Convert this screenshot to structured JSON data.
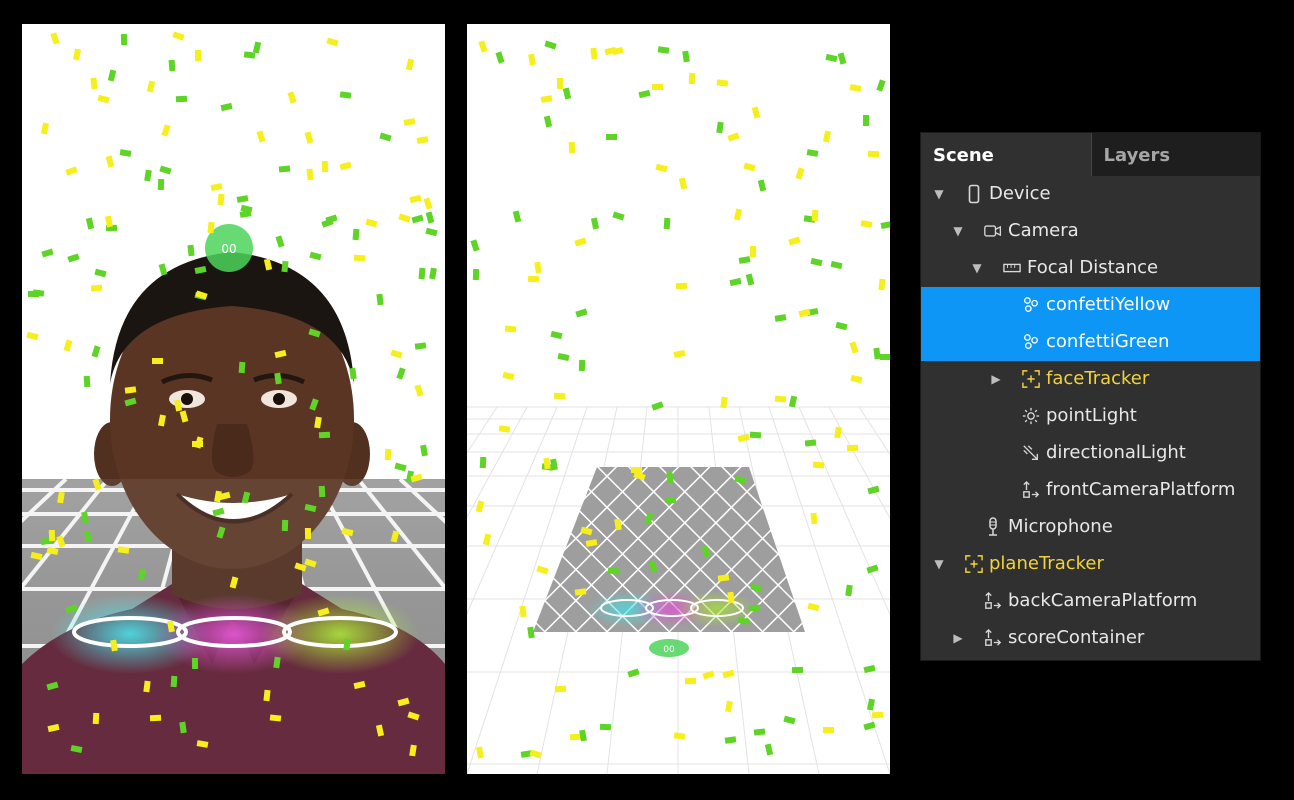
{
  "scene_panel": {
    "tabs": [
      {
        "label": "Scene",
        "active": true
      },
      {
        "label": "Layers",
        "active": false
      }
    ],
    "tree": [
      {
        "label": "Device",
        "depth": 0,
        "arrow": "expanded",
        "icon": "device-icon",
        "selected": false,
        "tracker": false
      },
      {
        "label": "Camera",
        "depth": 1,
        "arrow": "expanded",
        "icon": "camera-icon",
        "selected": false,
        "tracker": false
      },
      {
        "label": "Focal Distance",
        "depth": 2,
        "arrow": "expanded",
        "icon": "focal-distance-icon",
        "selected": false,
        "tracker": false
      },
      {
        "label": "confettiYellow",
        "depth": 3,
        "arrow": "none",
        "icon": "particle-system-icon",
        "selected": true,
        "tracker": false
      },
      {
        "label": "confettiGreen",
        "depth": 3,
        "arrow": "none",
        "icon": "particle-system-icon",
        "selected": true,
        "tracker": false
      },
      {
        "label": "faceTracker",
        "depth": 3,
        "arrow": "collapsed",
        "icon": "tracker-icon",
        "selected": false,
        "tracker": true
      },
      {
        "label": "pointLight",
        "depth": 3,
        "arrow": "none",
        "icon": "point-light-icon",
        "selected": false,
        "tracker": false
      },
      {
        "label": "directionalLight",
        "depth": 3,
        "arrow": "none",
        "icon": "directional-light-icon",
        "selected": false,
        "tracker": false
      },
      {
        "label": "frontCameraPlatform",
        "depth": 3,
        "arrow": "none",
        "icon": "platform-icon",
        "selected": false,
        "tracker": false
      },
      {
        "label": "Microphone",
        "depth": 1,
        "arrow": "none",
        "icon": "microphone-icon",
        "selected": false,
        "tracker": false
      },
      {
        "label": "planeTracker",
        "depth": 0,
        "arrow": "expanded",
        "icon": "tracker-icon",
        "selected": false,
        "tracker": true
      },
      {
        "label": "backCameraPlatform",
        "depth": 1,
        "arrow": "none",
        "icon": "platform-icon",
        "selected": false,
        "tracker": false
      },
      {
        "label": "scoreContainer",
        "depth": 1,
        "arrow": "collapsed",
        "icon": "platform-icon",
        "selected": false,
        "tracker": false
      }
    ]
  },
  "colors": {
    "panel_bg": "#303030",
    "tab_bar_bg": "#1e1e1e",
    "selection": "#0e96f7",
    "tracker_text": "#f2d33b",
    "confetti_yellow": "#f6ef1c",
    "confetti_green": "#5ed426",
    "tracker_badge": "#4cd35a",
    "ring_cyan": "#3fe3ea",
    "ring_magenta": "#e74bd8",
    "ring_lime": "#a6e82b"
  }
}
